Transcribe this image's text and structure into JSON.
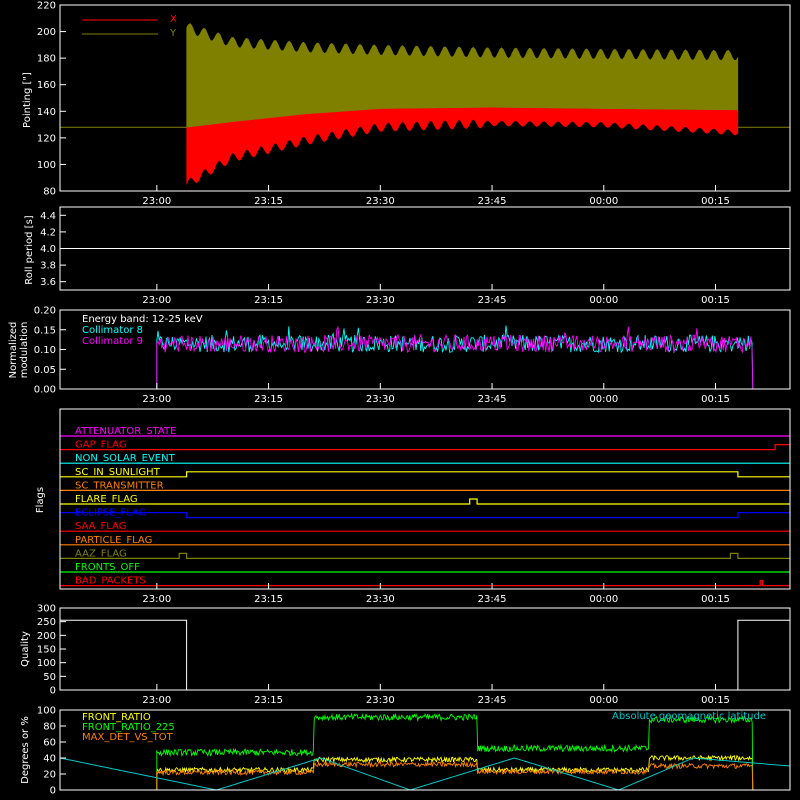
{
  "chart_data": [
    {
      "id": "pointing",
      "type": "line",
      "ylabel": "Pointing [\"]",
      "ylim": [
        80,
        220
      ],
      "yticks": [
        80,
        100,
        120,
        140,
        160,
        180,
        200,
        220
      ],
      "xlim": [
        "22:47",
        "00:25"
      ],
      "xticks": [
        "23:00",
        "23:15",
        "23:30",
        "23:45",
        "00:00",
        "00:15"
      ],
      "legend": {
        "placement": "top-left",
        "entries": [
          "X",
          "Y"
        ]
      },
      "series": [
        {
          "name": "X",
          "color": "#ff0000",
          "baseline_before": 128,
          "baseline_after": 128,
          "start": "23:04",
          "end": "00:18",
          "envelope_time": [
            "23:04",
            "23:10",
            "23:20",
            "23:30",
            "23:45",
            "00:00",
            "00:18"
          ],
          "envelope_low": [
            85,
            105,
            118,
            128,
            131,
            130,
            124
          ],
          "envelope_high": [
            128,
            132,
            138,
            142,
            143,
            142,
            141
          ]
        },
        {
          "name": "Y",
          "color": "#808000",
          "baseline_before": 128,
          "baseline_after": 128,
          "start": "23:04",
          "end": "00:18",
          "envelope_time": [
            "23:04",
            "23:10",
            "23:20",
            "23:30",
            "23:45",
            "00:00",
            "00:18"
          ],
          "envelope_low": [
            128,
            132,
            138,
            142,
            143,
            142,
            141
          ],
          "envelope_high": [
            203,
            192,
            188,
            186,
            184,
            183,
            182
          ]
        }
      ]
    },
    {
      "id": "roll",
      "type": "line",
      "ylabel": "Roll period [s]",
      "ylim": [
        3.5,
        4.5
      ],
      "yticks": [
        "3.6",
        "3.8",
        "4.0",
        "4.2",
        "4.4"
      ],
      "xticks": [
        "23:00",
        "23:15",
        "23:30",
        "23:45",
        "00:00",
        "00:15"
      ],
      "series": [
        {
          "color": "#ffffff",
          "value": 4.0
        }
      ]
    },
    {
      "id": "modulation",
      "type": "line",
      "ylabel_lines": [
        "Normalized",
        "modulation"
      ],
      "ylim": [
        0,
        0.2
      ],
      "yticks": [
        "0.00",
        "0.05",
        "0.10",
        "0.15",
        "0.20"
      ],
      "xticks": [
        "23:00",
        "23:15",
        "23:30",
        "23:45",
        "00:00",
        "00:15"
      ],
      "legend": {
        "placement": "top-left",
        "entries": [
          "Energy band: 12-25 keV",
          "Collimator 8",
          "Collimator 9"
        ]
      },
      "series": [
        {
          "name": "Collimator 8",
          "color": "#00ffff",
          "start": "23:00",
          "end": "00:20",
          "mean": 0.115,
          "spread": 0.022
        },
        {
          "name": "Collimator 9",
          "color": "#ff00ff",
          "start": "23:00",
          "end": "00:20",
          "mean": 0.115,
          "spread": 0.022
        }
      ]
    },
    {
      "id": "flags",
      "type": "line",
      "ylabel": "Flags",
      "xticks": [
        "23:00",
        "23:15",
        "23:30",
        "23:45",
        "00:00",
        "00:15"
      ],
      "flags": [
        {
          "label": "ATTENUATOR_STATE",
          "color": "#ff00ff",
          "segments": []
        },
        {
          "label": "GAP_FLAG",
          "color": "#ff0000",
          "segments": [
            [
              "00:23",
              "00:25"
            ]
          ]
        },
        {
          "label": "NON_SOLAR_EVENT",
          "color": "#00ffff",
          "segments": []
        },
        {
          "label": "SC_IN_SUNLIGHT",
          "color": "#ffff00",
          "segments": [
            [
              "23:04",
              "00:18"
            ]
          ]
        },
        {
          "label": "SC_TRANSMITTER",
          "color": "#ff8000",
          "segments": []
        },
        {
          "label": "FLARE_FLAG",
          "color": "#ffff00",
          "segments": [
            [
              "23:42",
              "23:43"
            ]
          ]
        },
        {
          "label": "ECLIPSE_FLAG",
          "color": "#0000ff",
          "segments": [
            [
              "22:47",
              "23:04"
            ],
            [
              "00:18",
              "00:25"
            ]
          ]
        },
        {
          "label": "SAA_FLAG",
          "color": "#ff0000",
          "segments": []
        },
        {
          "label": "PARTICLE_FLAG",
          "color": "#ff8000",
          "segments": []
        },
        {
          "label": "AAZ_FLAG",
          "color": "#808000",
          "segments": [
            [
              "23:03",
              "23:04"
            ],
            [
              "00:17",
              "00:18"
            ]
          ]
        },
        {
          "label": "FRONTS_OFF",
          "color": "#00ff00",
          "segments": []
        },
        {
          "label": "BAD_PACKETS",
          "color": "#ff0000",
          "segments": [
            [
              "00:21",
              "00:21.3"
            ]
          ]
        }
      ]
    },
    {
      "id": "quality",
      "type": "line",
      "ylabel": "Quality",
      "ylim": [
        0,
        300
      ],
      "yticks": [
        "0",
        "50",
        "100",
        "150",
        "200",
        "250",
        "300"
      ],
      "xticks": [
        "23:00",
        "23:15",
        "23:30",
        "23:45",
        "00:00",
        "00:15"
      ],
      "series": [
        {
          "color": "#ffffff",
          "time": [
            "22:47",
            "23:04",
            "23:04",
            "00:18",
            "00:18",
            "00:25"
          ],
          "values": [
            255,
            255,
            0,
            0,
            255,
            255
          ]
        }
      ]
    },
    {
      "id": "ratios",
      "type": "line",
      "ylabel": "Degrees or %",
      "ylim": [
        0,
        100
      ],
      "yticks": [
        "0",
        "20",
        "40",
        "60",
        "80",
        "100"
      ],
      "legend": {
        "placement": "top-left",
        "entries": [
          "FRONT_RATIO",
          "FRONT_RATIO_225",
          "MAX_DET_VS_TOT"
        ],
        "right_entry": "Absolute geomagnetic latitude"
      },
      "series": [
        {
          "name": "FRONT_RATIO",
          "color": "#ffff00",
          "start": "23:00",
          "end": "00:20",
          "time": [
            "23:00",
            "23:21",
            "23:21",
            "23:43",
            "23:43",
            "00:06",
            "00:06",
            "00:20"
          ],
          "values": [
            25,
            25,
            38,
            38,
            25,
            25,
            40,
            40
          ],
          "noise": 3
        },
        {
          "name": "FRONT_RATIO_225",
          "color": "#00ff00",
          "start": "23:00",
          "end": "00:20",
          "time": [
            "23:00",
            "23:21",
            "23:21",
            "23:43",
            "23:43",
            "00:06",
            "00:06",
            "00:20"
          ],
          "values": [
            47,
            47,
            91,
            91,
            52,
            52,
            88,
            88
          ],
          "noise": 4
        },
        {
          "name": "MAX_DET_VS_TOT",
          "color": "#ff8000",
          "start": "23:00",
          "end": "00:20",
          "time": [
            "23:00",
            "23:21",
            "23:21",
            "23:43",
            "23:43",
            "00:06",
            "00:06",
            "00:20"
          ],
          "values": [
            22,
            22,
            32,
            32,
            23,
            23,
            30,
            30
          ],
          "noise": 3
        },
        {
          "name": "Absolute geomagnetic latitude",
          "color": "#00c8c8",
          "time": [
            "22:47",
            "23:08",
            "23:22",
            "23:34",
            "23:48",
            "00:02",
            "00:12",
            "00:25"
          ],
          "values": [
            40,
            0,
            40,
            0,
            40,
            0,
            40,
            30
          ],
          "smooth": true
        }
      ]
    }
  ]
}
